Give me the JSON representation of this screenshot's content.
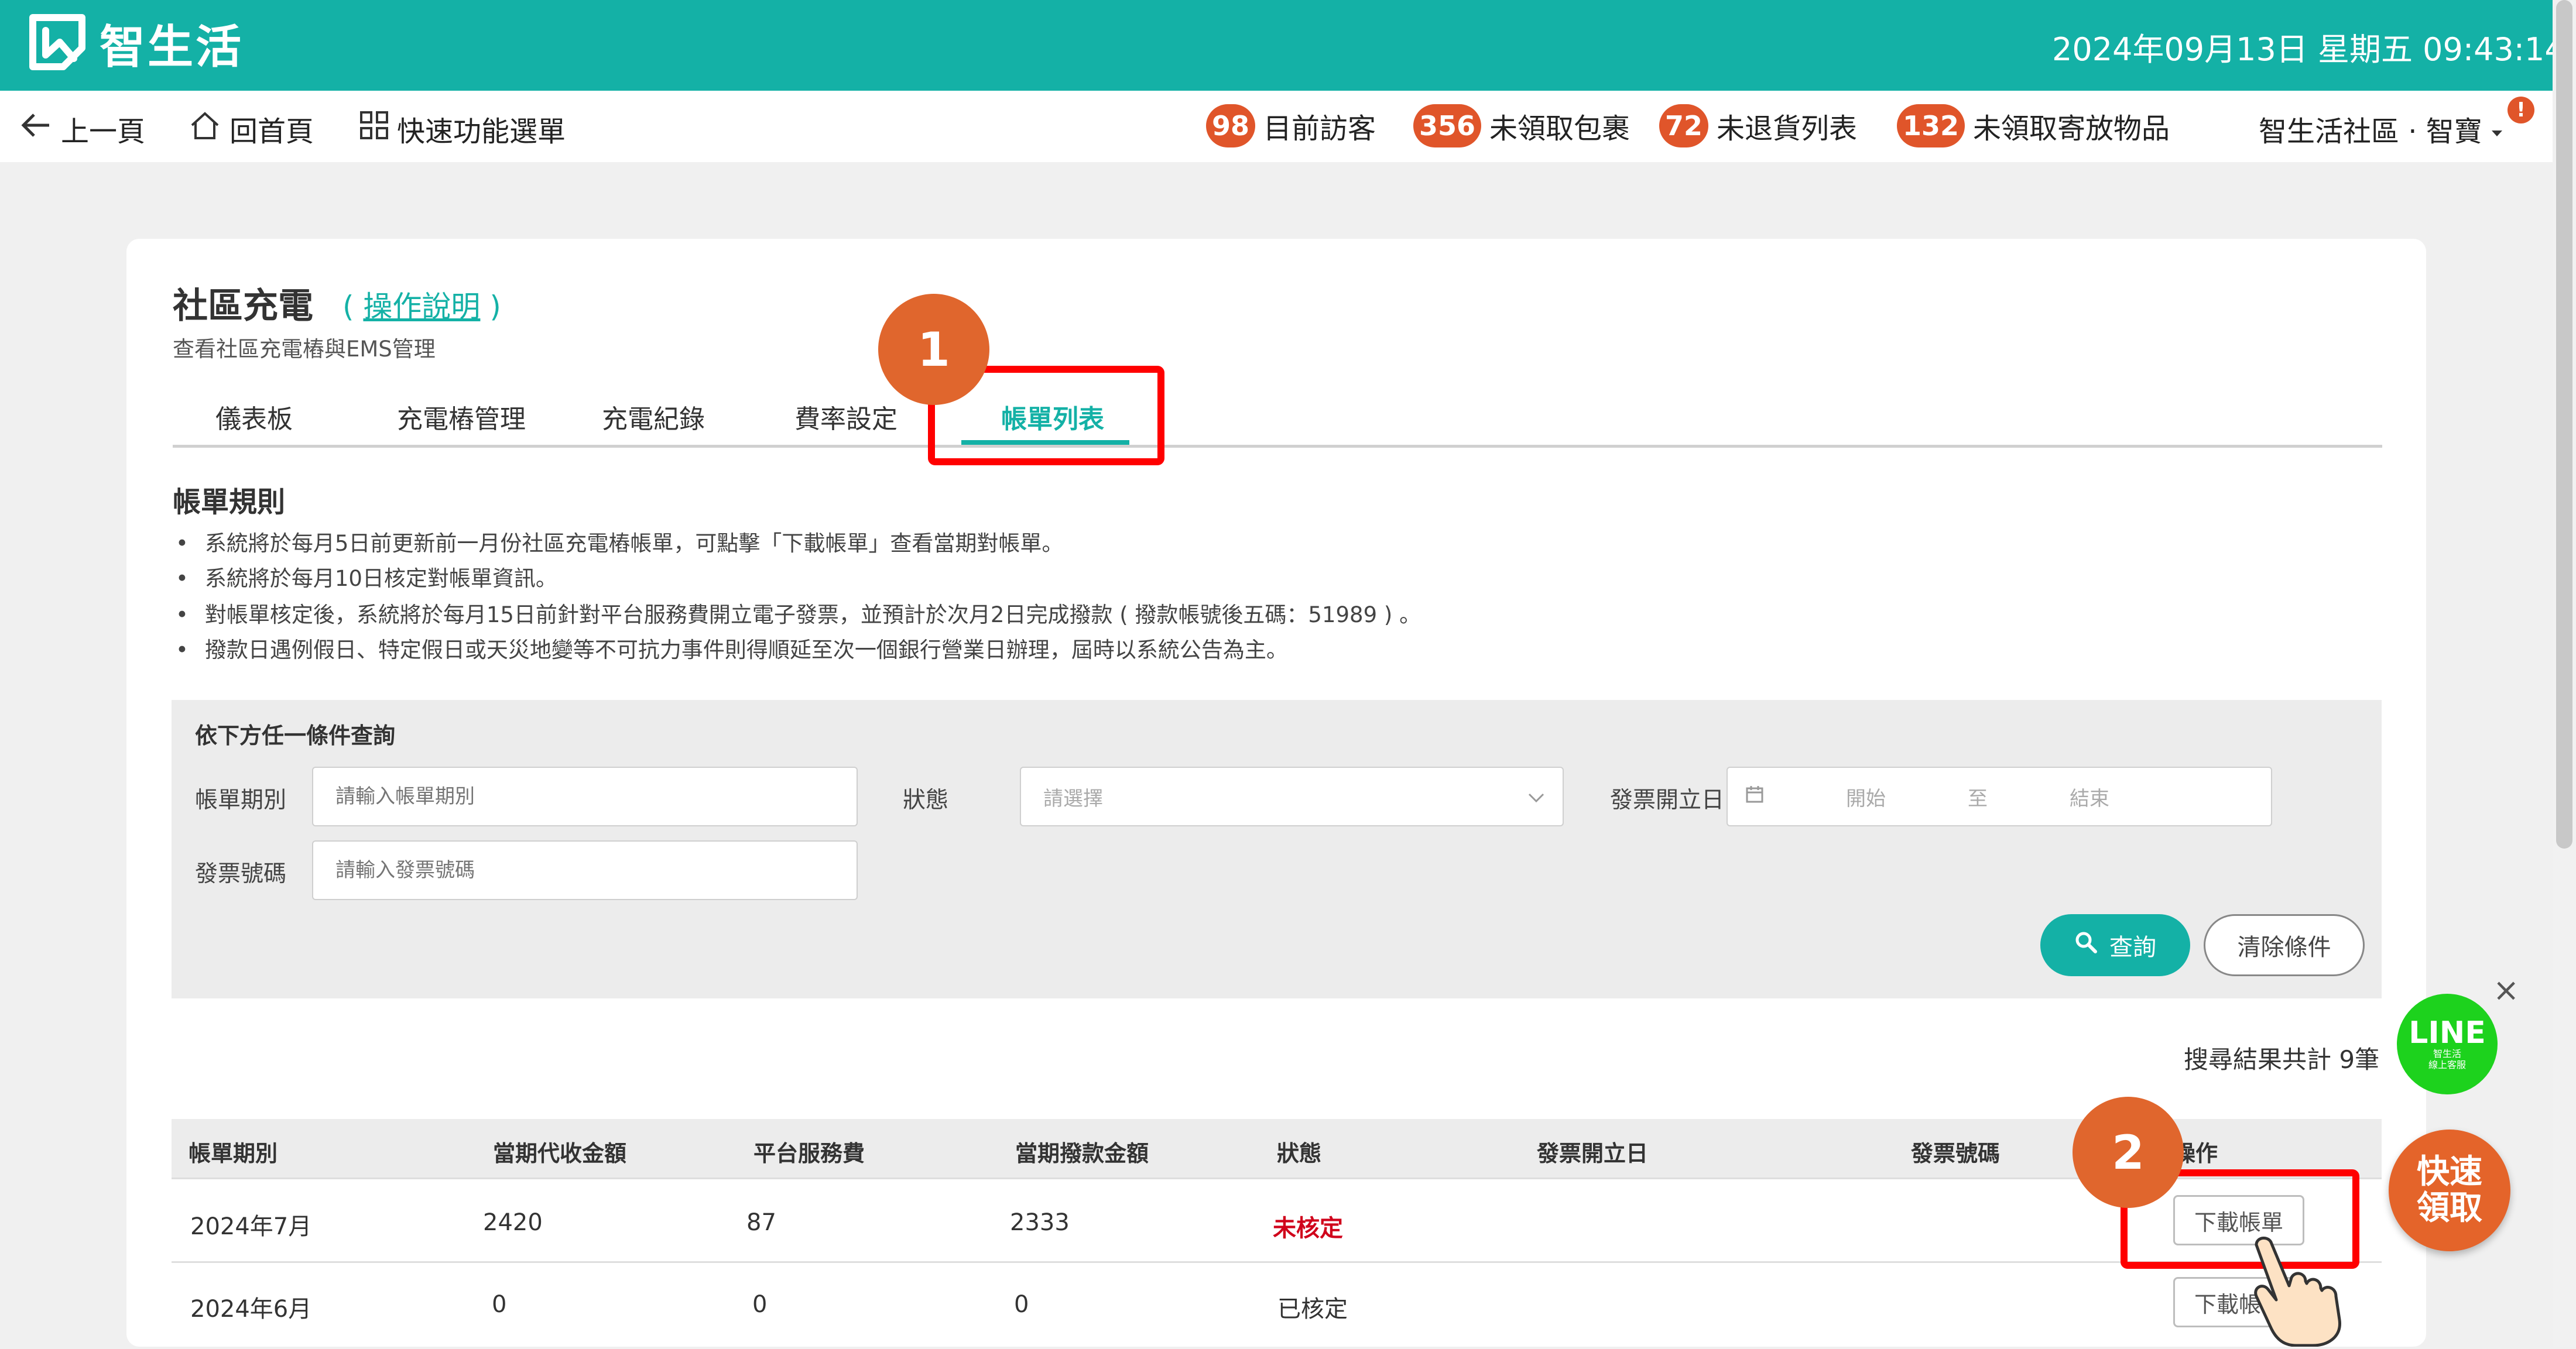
{
  "header": {
    "app_name": "智生活",
    "datetime": "2024年09月13日 星期五 09:43:14"
  },
  "nav": {
    "back_label": "上一頁",
    "home_label": "回首頁",
    "quick_menu_label": "快速功能選單",
    "stats": [
      {
        "count": "98",
        "label": "目前訪客"
      },
      {
        "count": "356",
        "label": "未領取包裹"
      },
      {
        "count": "72",
        "label": "未退貨列表"
      },
      {
        "count": "132",
        "label": "未領取寄放物品"
      }
    ],
    "user_label": "智生活社區 · 智寶",
    "notif_badge": "!"
  },
  "page": {
    "title": "社區充電",
    "help_open": "(",
    "help_link": "操作說明",
    "help_close": ")",
    "subtitle": "查看社區充電樁與EMS管理"
  },
  "tabs": [
    {
      "label": "儀表板"
    },
    {
      "label": "充電樁管理"
    },
    {
      "label": "充電紀錄"
    },
    {
      "label": "費率設定"
    },
    {
      "label": "帳單列表"
    }
  ],
  "rules": {
    "title": "帳單規則",
    "items": [
      "系統將於每月5日前更新前一月份社區充電樁帳單，可點擊「下載帳單」查看當期對帳單。",
      "系統將於每月10日核定對帳單資訊。",
      "對帳單核定後，系統將於每月15日前針對平台服務費開立電子發票，並預計於次月2日完成撥款 ( 撥款帳號後五碼：51989 ) 。",
      "撥款日遇例假日、特定假日或天災地變等不可抗力事件則得順延至次一個銀行營業日辦理，屆時以系統公告為主。"
    ]
  },
  "filter": {
    "title": "依下方任一條件查詢",
    "period_label": "帳單期別",
    "period_placeholder": "請輸入帳單期別",
    "status_label": "狀態",
    "status_placeholder": "請選擇",
    "invoice_date_label": "發票開立日",
    "date_start": "開始",
    "date_to": "至",
    "date_end": "結束",
    "invoice_no_label": "發票號碼",
    "invoice_no_placeholder": "請輸入發票號碼",
    "search_label": "查詢",
    "clear_label": "清除條件"
  },
  "result_count": "搜尋結果共計 9筆",
  "table": {
    "headers": [
      "帳單期別",
      "當期代收金額",
      "平台服務費",
      "當期撥款金額",
      "狀態",
      "發票開立日",
      "發票號碼",
      "操作"
    ],
    "rows": [
      {
        "period": "2024年7月",
        "collected": "2420",
        "fee": "87",
        "payout": "2333",
        "status": "未核定",
        "invoice_date": "",
        "invoice_no": "",
        "action": "下載帳單"
      },
      {
        "period": "2024年6月",
        "collected": "0",
        "fee": "0",
        "payout": "0",
        "status": "已核定",
        "invoice_date": "",
        "invoice_no": "",
        "action": "下載帳單"
      }
    ]
  },
  "annotations": {
    "step1": "1",
    "step2": "2"
  },
  "floating": {
    "line_label": "LINE",
    "line_sub1": "智生活",
    "line_sub2": "線上客服",
    "close": "×",
    "quick_pickup_line1": "快速",
    "quick_pickup_line2": "領取"
  },
  "colors": {
    "brand": "#14b1a6",
    "badge": "#e0552a",
    "alert": "#d0021b",
    "highlight": "#ff0000",
    "line_green": "#1dd21d"
  }
}
